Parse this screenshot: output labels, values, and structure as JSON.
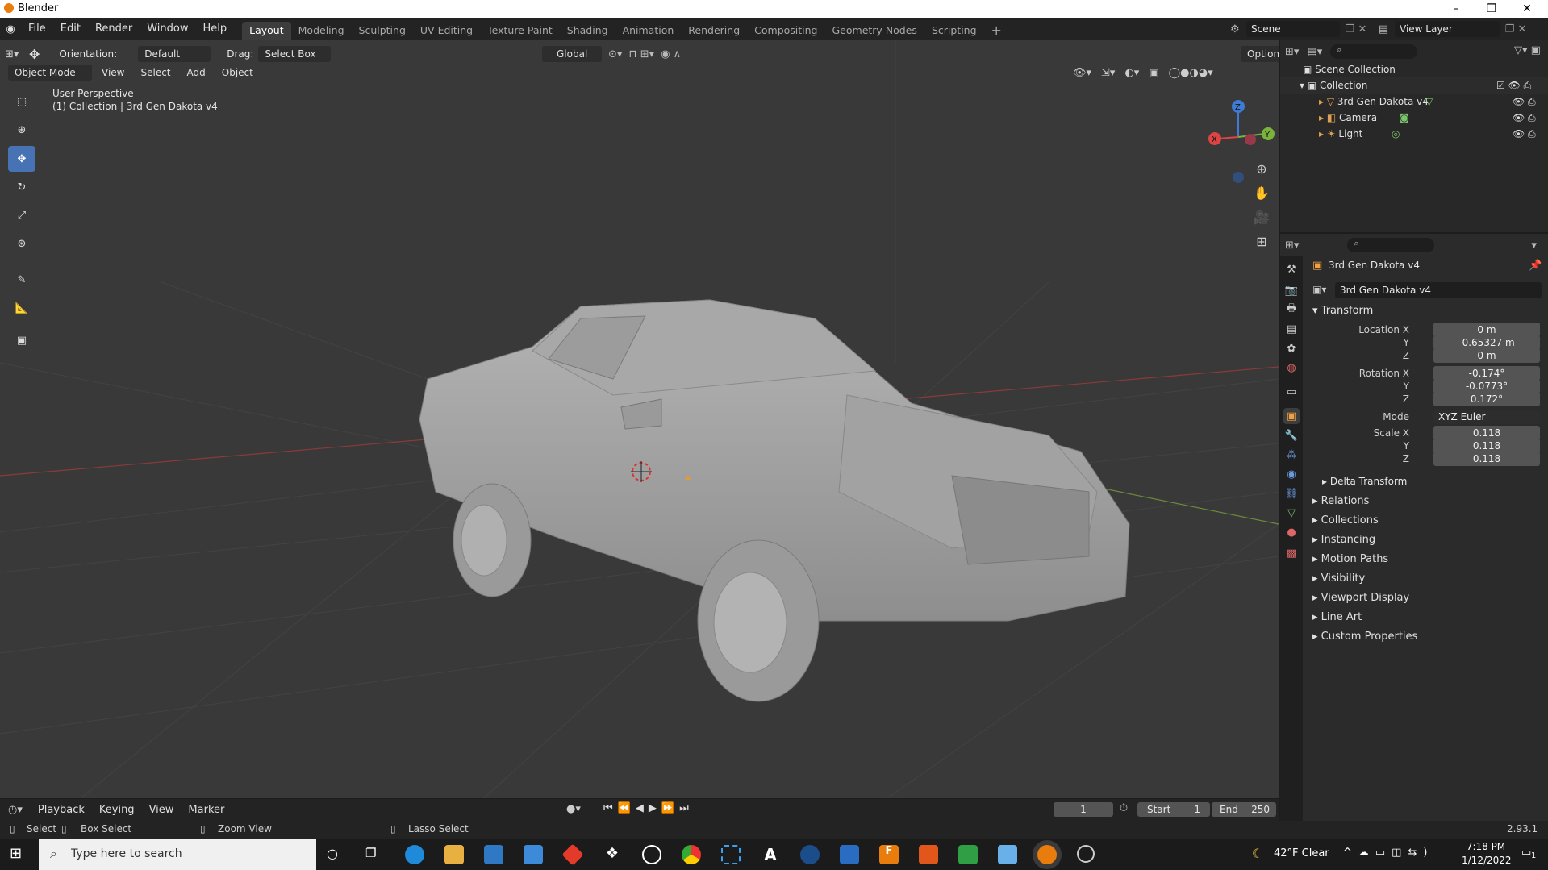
{
  "window": {
    "title": "Blender",
    "min": "–",
    "max": "❐",
    "close": "✕"
  },
  "menu": [
    "File",
    "Edit",
    "Render",
    "Window",
    "Help"
  ],
  "workspaces": [
    "Layout",
    "Modeling",
    "Sculpting",
    "UV Editing",
    "Texture Paint",
    "Shading",
    "Animation",
    "Rendering",
    "Compositing",
    "Geometry Nodes",
    "Scripting"
  ],
  "active_workspace": "Layout",
  "scene": {
    "name": "Scene",
    "view_layer": "View Layer"
  },
  "tool_header": {
    "orientation_label": "Orientation:",
    "orientation_value": "Default",
    "drag_label": "Drag:",
    "drag_value": "Select Box",
    "transform_space": "Global",
    "options": "Options"
  },
  "viewport_header": {
    "mode": "Object Mode",
    "menus": [
      "View",
      "Select",
      "Add",
      "Object"
    ]
  },
  "viewport": {
    "perspective": "User Perspective",
    "collection_info": "(1) Collection | 3rd Gen Dakota v4",
    "gizmo": {
      "x": "X",
      "y": "Y",
      "z": "Z"
    }
  },
  "outliner": {
    "root": "Scene Collection",
    "collection": "Collection",
    "items": [
      "3rd Gen Dakota v4",
      "Camera",
      "Light"
    ]
  },
  "properties": {
    "object_name": "3rd Gen Dakota v4",
    "datablock_name": "3rd Gen Dakota v4",
    "transform_title": "Transform",
    "location_label": "Location X",
    "location": {
      "x": "0 m",
      "y": "-0.65327 m",
      "z": "0 m"
    },
    "rotation_label": "Rotation X",
    "rotation": {
      "x": "-0.174°",
      "y": "-0.0773°",
      "z": "0.172°"
    },
    "mode_label": "Mode",
    "mode_value": "XYZ Euler",
    "scale_label": "Scale X",
    "scale": {
      "x": "0.118",
      "y": "0.118",
      "z": "0.118"
    },
    "axis_y": "Y",
    "axis_z": "Z",
    "delta": "Delta Transform",
    "panels": [
      "Relations",
      "Collections",
      "Instancing",
      "Motion Paths",
      "Visibility",
      "Viewport Display",
      "Line Art",
      "Custom Properties"
    ]
  },
  "timeline": {
    "menus": [
      "Playback",
      "Keying",
      "View",
      "Marker"
    ],
    "current_frame": "1",
    "start_label": "Start",
    "start": "1",
    "end_label": "End",
    "end": "250"
  },
  "statusbar": {
    "select": "Select",
    "box_select": "Box Select",
    "zoom_view": "Zoom View",
    "lasso_select": "Lasso Select",
    "version": "2.93.1"
  },
  "taskbar": {
    "search_placeholder": "Type here to search",
    "weather": "42°F  Clear",
    "time": "7:18 PM",
    "date": "1/12/2022",
    "notifications": "1"
  }
}
